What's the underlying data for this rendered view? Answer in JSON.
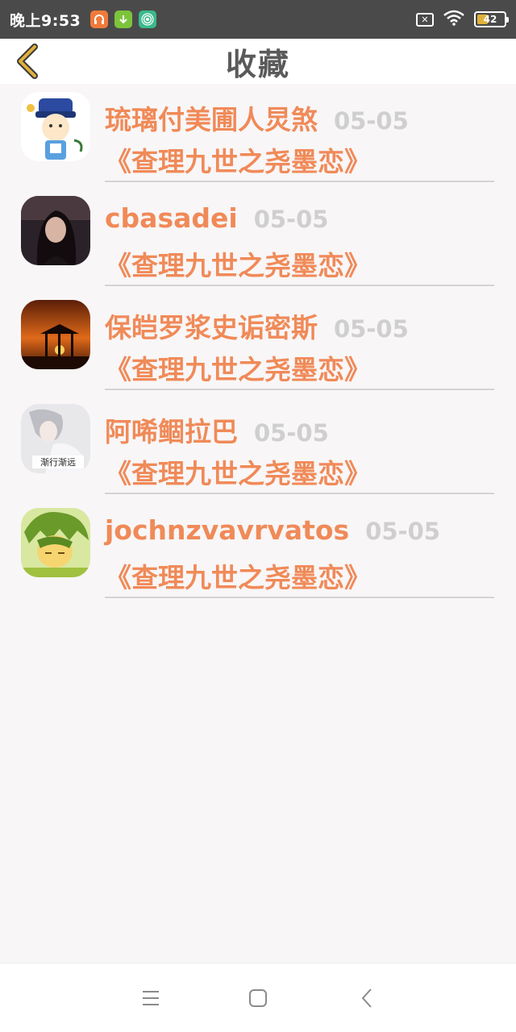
{
  "status_bar": {
    "time": "晚上9:53",
    "battery": "42",
    "battery_level": 0.42,
    "notification_icons": [
      "headphone-app-icon",
      "download-icon",
      "hotspot-icon"
    ]
  },
  "header": {
    "title": "收藏",
    "back_icon": "chevron-left-icon"
  },
  "favorites": [
    {
      "user": "琉璃付美圃人炅煞",
      "date": "05-05",
      "book": "《查理九世之尧墨恋》",
      "avatar": "cartoon-character-avatar"
    },
    {
      "user": "cbasadei",
      "date": "05-05",
      "book": "《查理九世之尧墨恋》",
      "avatar": "woman-portrait-avatar"
    },
    {
      "user": "保皑罗浆史诟密斯",
      "date": "05-05",
      "book": "《查理九世之尧墨恋》",
      "avatar": "sunset-pavilion-avatar"
    },
    {
      "user": "阿唏鲴拉巴",
      "date": "05-05",
      "book": "《查理九世之尧墨恋》",
      "avatar": "portrait-caption-avatar",
      "avatar_caption": "渐行渐远"
    },
    {
      "user": "jochnzvavrvatos",
      "date": "05-05",
      "book": "《查理九世之尧墨恋》",
      "avatar": "anime-boy-avatar"
    }
  ],
  "colors": {
    "accent": "#f08a58",
    "date": "#cfcfcf",
    "title": "#5a5a5a",
    "back_icon": "#e0b13a"
  },
  "nav_bar": {
    "icons": [
      "menu-icon",
      "home-square-icon",
      "back-triangle-icon"
    ]
  }
}
